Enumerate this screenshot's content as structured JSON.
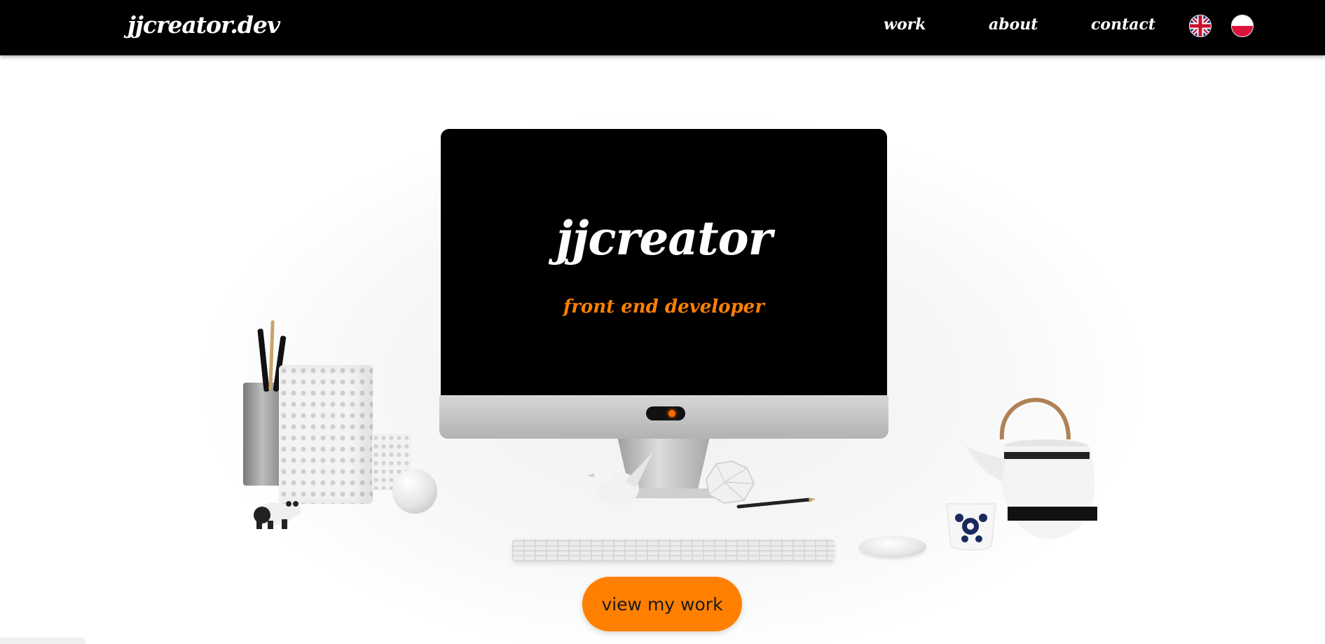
{
  "nav": {
    "brand": "jjcreator.dev",
    "links": [
      {
        "label": "work"
      },
      {
        "label": "about"
      },
      {
        "label": "contact"
      }
    ],
    "languages": [
      {
        "code": "en",
        "icon": "uk-flag-icon"
      },
      {
        "code": "pl",
        "icon": "poland-flag-icon"
      }
    ]
  },
  "hero": {
    "title": "jjcreator",
    "subtitle": "front end developer",
    "cta_label": "view my work"
  },
  "colors": {
    "accent": "#ff8000",
    "navbar": "#000000",
    "background": "#ffffff"
  }
}
